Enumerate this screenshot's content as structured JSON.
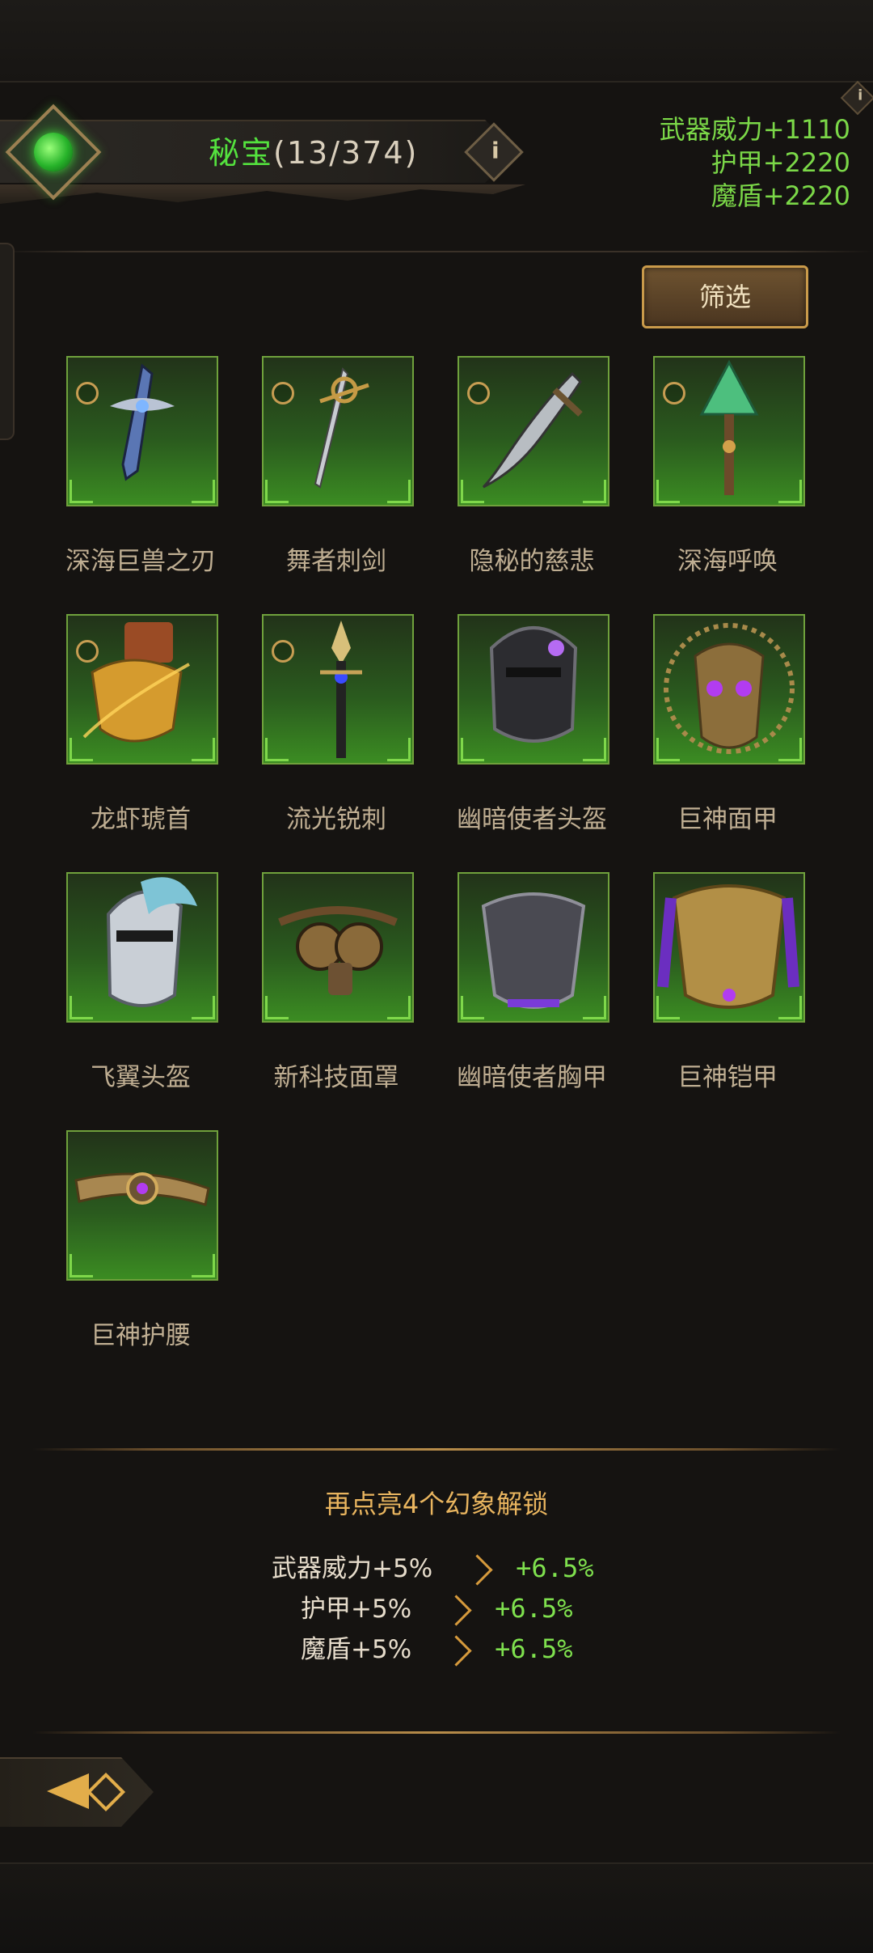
{
  "header": {
    "title": "秘宝",
    "count": "(13/374)",
    "info_icon": "i",
    "corner_info_icon": "i"
  },
  "stats": [
    "武器威力+1110",
    "护甲+2220",
    "魔盾+2220"
  ],
  "filter_label": "筛选",
  "items": [
    {
      "name": "深海巨兽之刃",
      "selectable": true,
      "icon": "sword-icon"
    },
    {
      "name": "舞者刺剑",
      "selectable": true,
      "icon": "rapier-icon"
    },
    {
      "name": "隐秘的慈悲",
      "selectable": true,
      "icon": "curved-blade-icon"
    },
    {
      "name": "深海呼唤",
      "selectable": true,
      "icon": "shell-mace-icon"
    },
    {
      "name": "龙虾琥首",
      "selectable": true,
      "icon": "gauntlet-icon"
    },
    {
      "name": "流光锐刺",
      "selectable": true,
      "icon": "spear-icon"
    },
    {
      "name": "幽暗使者头盔",
      "selectable": false,
      "icon": "helmet-icon"
    },
    {
      "name": "巨神面甲",
      "selectable": false,
      "icon": "mask-icon"
    },
    {
      "name": "飞翼头盔",
      "selectable": false,
      "icon": "winged-helmet-icon"
    },
    {
      "name": "新科技面罩",
      "selectable": false,
      "icon": "goggles-mask-icon"
    },
    {
      "name": "幽暗使者胸甲",
      "selectable": false,
      "icon": "chest-armor-icon"
    },
    {
      "name": "巨神铠甲",
      "selectable": false,
      "icon": "golden-armor-icon"
    },
    {
      "name": "巨神护腰",
      "selectable": false,
      "icon": "belt-icon"
    }
  ],
  "unlock": {
    "title": "再点亮4个幻象解锁",
    "bonuses": [
      {
        "label": "武器威力+5%",
        "value": "+6.5%"
      },
      {
        "label": "护甲+5%",
        "value": "+6.5%"
      },
      {
        "label": "魔盾+5%",
        "value": "+6.5%"
      }
    ]
  },
  "colors": {
    "stat_green": "#7bd848",
    "title_green": "#54e23e",
    "unlock_gold": "#e9b55f",
    "tile_border": "#6fa13c"
  }
}
